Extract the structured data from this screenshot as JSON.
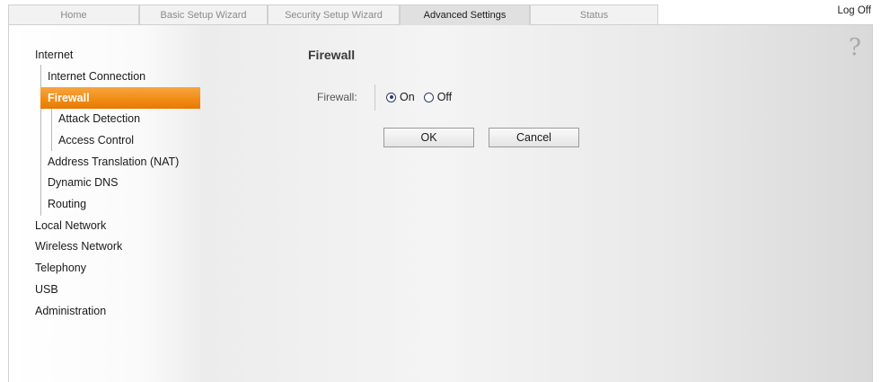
{
  "tabs": [
    {
      "label": "Home"
    },
    {
      "label": "Basic Setup Wizard"
    },
    {
      "label": "Security Setup Wizard"
    },
    {
      "label": "Advanced Settings",
      "active": true
    },
    {
      "label": "Status"
    }
  ],
  "header": {
    "logoff_label": "Log Off"
  },
  "sidebar": {
    "items": [
      {
        "label": "Internet"
      },
      {
        "label": "Internet Connection"
      },
      {
        "label": "Firewall",
        "active": true
      },
      {
        "label": "Attack Detection"
      },
      {
        "label": "Access Control"
      },
      {
        "label": "Address Translation (NAT)"
      },
      {
        "label": "Dynamic DNS"
      },
      {
        "label": "Routing"
      },
      {
        "label": "Local Network"
      },
      {
        "label": "Wireless Network"
      },
      {
        "label": "Telephony"
      },
      {
        "label": "USB"
      },
      {
        "label": "Administration"
      }
    ]
  },
  "main": {
    "help_glyph": "?",
    "title": "Firewall",
    "firewall_label": "Firewall:",
    "options": [
      {
        "label": "On",
        "checked": true
      },
      {
        "label": "Off",
        "checked": false
      }
    ],
    "ok_label": "OK",
    "cancel_label": "Cancel"
  },
  "colors": {
    "accent": "#f08a13",
    "radio": "#2c3a66"
  }
}
